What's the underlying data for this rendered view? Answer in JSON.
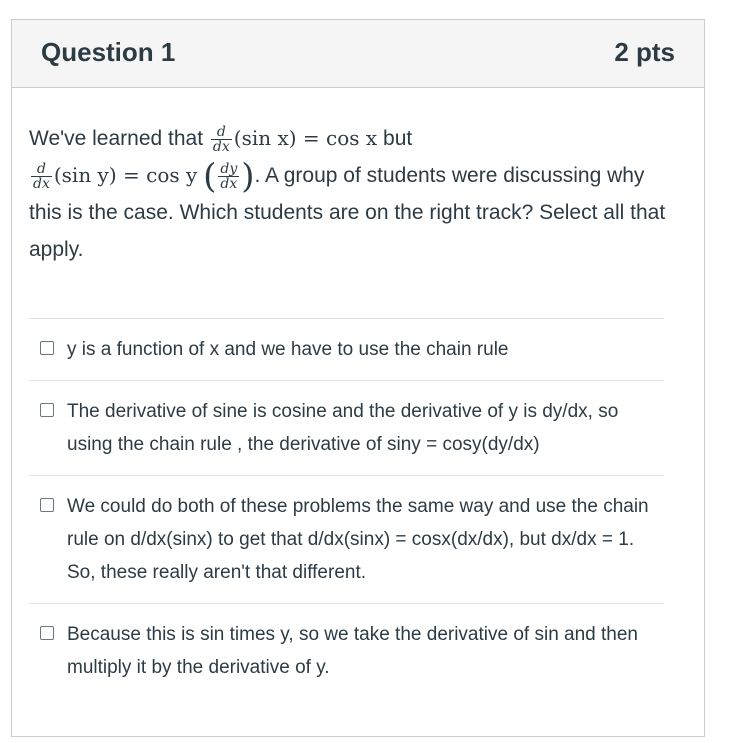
{
  "question": {
    "title": "Question 1",
    "points": "2 pts",
    "text": {
      "intro": "We've learned that",
      "math1_num": "d",
      "math1_den": "dx",
      "math1_expr": "(sin x) = cos x",
      "but": "but",
      "math2_num": "d",
      "math2_den": "dx",
      "math2_expr": "(sin y) = cos y",
      "math2_frac_num": "dy",
      "math2_frac_den": "dx",
      "rest": ". A group of students were discussing why this is the case. Which students are on the right track? Select all that apply."
    }
  },
  "answers": [
    {
      "label": "y is a function of x and we have to use the chain rule",
      "checked": false
    },
    {
      "label": "The derivative of sine is cosine and the derivative of y is dy/dx, so using the chain rule , the derivative of siny = cosy(dy/dx)",
      "checked": false
    },
    {
      "label": "We could do both of these problems the same way and use the chain rule on d/dx(sinx) to get that d/dx(sinx) = cosx(dx/dx), but dx/dx = 1. So, these really aren't that different.",
      "checked": false
    },
    {
      "label": "Because this is sin times y, so we take the derivative of sin and then multiply it by the derivative of y.",
      "checked": false
    }
  ]
}
